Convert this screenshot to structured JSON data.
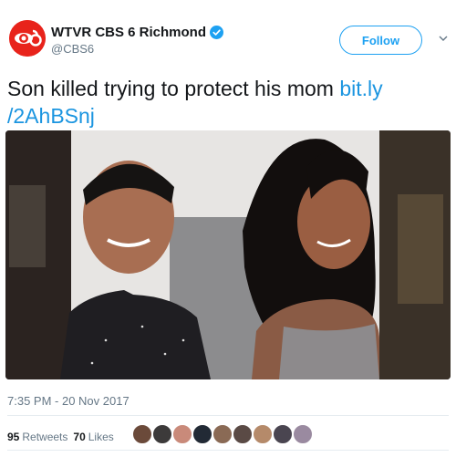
{
  "account": {
    "display_name": "WTVR CBS 6 Richmond",
    "handle": "@CBS6",
    "verified": true,
    "avatar_icon": "cbs6-logo-icon"
  },
  "follow_label": "Follow",
  "tweet": {
    "text": "Son killed trying to protect his mom ",
    "link": "bit.ly /2AhBSnj",
    "timestamp": "7:35 PM - 20 Nov 2017"
  },
  "stats": {
    "retweets_count": "95",
    "retweets_label": "Retweets",
    "likes_count": "70",
    "likes_label": "Likes"
  },
  "colors": {
    "accent": "#1da1f2",
    "link": "#1b95e0",
    "brand_red": "#e8231b"
  },
  "likers": [
    {
      "color": "#6b4a3a"
    },
    {
      "color": "#3c3a3a"
    },
    {
      "color": "#c98a7a"
    },
    {
      "color": "#222a35"
    },
    {
      "color": "#8a6a55"
    },
    {
      "color": "#5a4a45"
    },
    {
      "color": "#b58a6a"
    },
    {
      "color": "#4a4550"
    },
    {
      "color": "#9a8aa0"
    }
  ]
}
